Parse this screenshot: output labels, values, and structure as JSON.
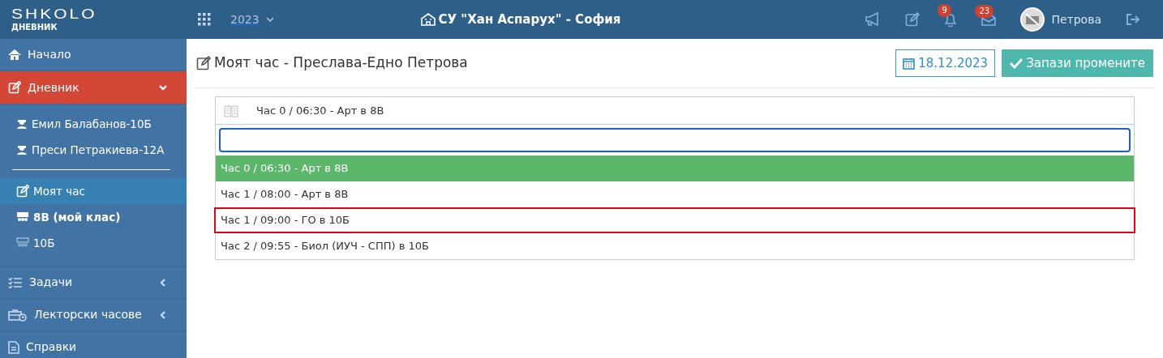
{
  "brand": {
    "logo": "SHKOLO",
    "subtitle": "ДНЕВНИК"
  },
  "topbar": {
    "year": "2023",
    "school": "СУ \"Хан Аспарух\" - София",
    "notifications": "9",
    "messages": "23",
    "user": "Петрова"
  },
  "sidebar": {
    "items": [
      {
        "label": "Начало",
        "selected": false,
        "expandable": false
      },
      {
        "label": "Дневник",
        "selected": true,
        "expandable": true,
        "expanded": true,
        "children": [
          {
            "kind": "person",
            "label": "Емил Балабанов-10Б",
            "selected": false,
            "bold": false
          },
          {
            "kind": "person",
            "label": "Преси Петракиева-12А",
            "selected": false,
            "bold": false
          },
          {
            "kind": "divider"
          },
          {
            "kind": "page",
            "label": "Моят час",
            "selected": true,
            "bold": false
          },
          {
            "kind": "class",
            "label": "8В (мой клас)",
            "selected": false,
            "bold": true
          },
          {
            "kind": "class",
            "label": "10Б",
            "selected": false,
            "bold": false
          }
        ]
      },
      {
        "label": "Задачи",
        "selected": false,
        "expandable": true,
        "expanded": false
      },
      {
        "label": "Лекторски часове",
        "selected": false,
        "expandable": true,
        "expanded": false
      },
      {
        "label": "Справки",
        "selected": false,
        "expandable": false
      }
    ]
  },
  "page": {
    "title": "Моят час - Преслава-Едно Петрова",
    "date": "18.12.2023",
    "save_button": "Запази промените"
  },
  "lesson_select": {
    "value": "Час 0 / 06:30 - Арт в 8В",
    "expanded": true,
    "options": [
      {
        "label": "Час 0 / 06:30 - Арт в 8В",
        "selected": true,
        "outlined": false
      },
      {
        "label": "Час 1 / 08:00 - Арт в 8В",
        "selected": false,
        "outlined": false
      },
      {
        "label": "Час 1 / 09:00 - ГО в 10Б",
        "selected": false,
        "outlined": true
      },
      {
        "label": "Час 2 / 09:55 - Биол (ИУЧ - СПП) в 10Б",
        "selected": false,
        "outlined": false
      }
    ]
  }
}
